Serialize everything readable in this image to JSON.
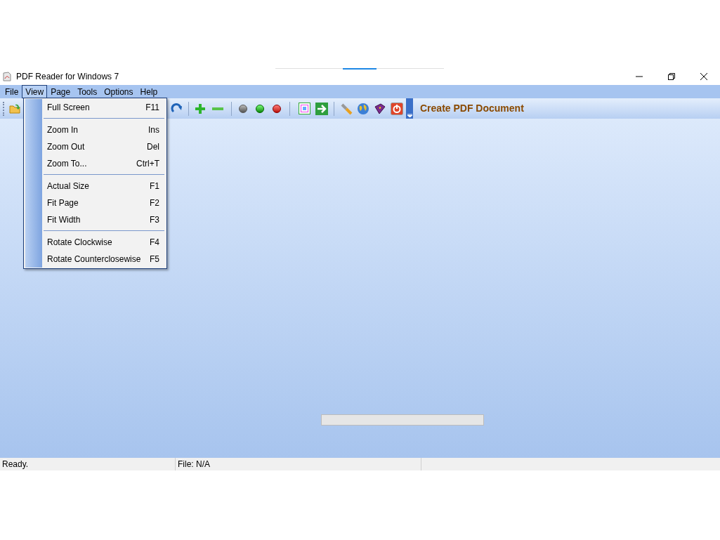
{
  "window": {
    "title": "PDF Reader for Windows 7"
  },
  "menu_bar": [
    {
      "label": "File",
      "selected": false
    },
    {
      "label": "View",
      "selected": true
    },
    {
      "label": "Page",
      "selected": false
    },
    {
      "label": "Tools",
      "selected": false
    },
    {
      "label": "Options",
      "selected": false
    },
    {
      "label": "Help",
      "selected": false
    }
  ],
  "view_menu": [
    {
      "kind": "item",
      "label": "Full Screen",
      "shortcut": "F11"
    },
    {
      "kind": "separator"
    },
    {
      "kind": "item",
      "label": "Zoom In",
      "shortcut": "Ins"
    },
    {
      "kind": "item",
      "label": "Zoom Out",
      "shortcut": "Del"
    },
    {
      "kind": "item",
      "label": "Zoom To...",
      "shortcut": "Ctrl+T"
    },
    {
      "kind": "separator"
    },
    {
      "kind": "item",
      "label": "Actual Size",
      "shortcut": "F1"
    },
    {
      "kind": "item",
      "label": "Fit Page",
      "shortcut": "F2"
    },
    {
      "kind": "item",
      "label": "Fit Width",
      "shortcut": "F3"
    },
    {
      "kind": "separator"
    },
    {
      "kind": "item",
      "label": "Rotate Clockwise",
      "shortcut": "F4"
    },
    {
      "kind": "item",
      "label": "Rotate Counterclosewise",
      "shortcut": "F5"
    }
  ],
  "toolbar": {
    "create_pdf_label": "Create PDF Document"
  },
  "progress_bar": {
    "level": 0
  },
  "status_bar": [
    "Ready.",
    "File: N/A"
  ]
}
